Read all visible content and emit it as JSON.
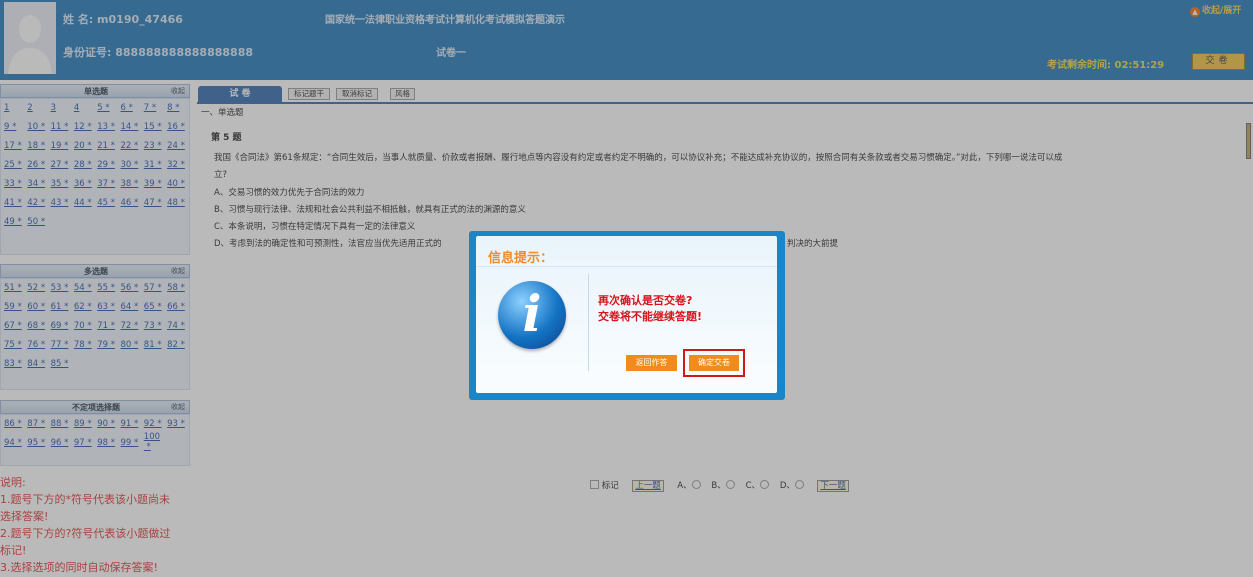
{
  "header": {
    "name_label": "姓 名: m0190_47466",
    "id_label": "身份证号: 888888888888888888",
    "exam_title": "国家统一法律职业资格考试计算机化考试模拟答题演示",
    "paper_name": "试卷一",
    "timer_label": "考试剩余时间: 02:51:29",
    "submit_label": "交卷",
    "fav_label": "收起/展开"
  },
  "left": {
    "sections": [
      {
        "title": "单选题",
        "toggle": "收起"
      },
      {
        "title": "多选题",
        "toggle": "收起"
      },
      {
        "title": "不定项选择题",
        "toggle": "收起"
      }
    ],
    "notes": [
      "说明:",
      "1.题号下方的*符号代表该小题尚未",
      "选择答案!",
      "2.题号下方的?符号代表该小题做过",
      "标记!",
      "3.选择选项的同时自动保存答案!"
    ]
  },
  "main": {
    "tab_label": "试 卷",
    "buttons": [
      "标记题干",
      "取消标记",
      "风格"
    ],
    "section_title": "一、单选题",
    "question_number": "第 5 题",
    "question_text1": "我国《合同法》第61条规定：“合同生效后，当事人就质量、价款或者报酬、履行地点等内容没有约定或者约定不明确的，可以协议补充；不能达成补充协议的，按照合同有关条款或者交易习惯确定。”对此，下列哪一说法可以成",
    "question_text2": "立?",
    "options": [
      "A、交易习惯的效力优先于合同法的效力",
      "B、习惯与现行法律、法规和社会公共利益不相抵触，就具有正式的法的渊源的意义",
      "C、本条说明，习惯在特定情况下具有一定的法律意义",
      "D、考虑到法的确定性和可预测性，法官应当优先适用正式的",
      "判决的大前提"
    ],
    "nav": {
      "mark_label": "标记",
      "prev_label": "上一题",
      "option_labels": [
        "A、",
        "B、",
        "C、",
        "D、"
      ],
      "next_label": "下一题"
    }
  },
  "dialog": {
    "title": "信息提示：",
    "icon": "info-icon",
    "message1": "再次确认是否交卷?",
    "message2": "交卷将不能继续答题!",
    "back_label": "返回作答",
    "confirm_label": "确定交卷"
  },
  "colors": {
    "header_bg": "#1c75b9",
    "accent_orange": "#f08c1e",
    "warning_red": "#d8141c",
    "timer_yellow": "#f0d840"
  }
}
